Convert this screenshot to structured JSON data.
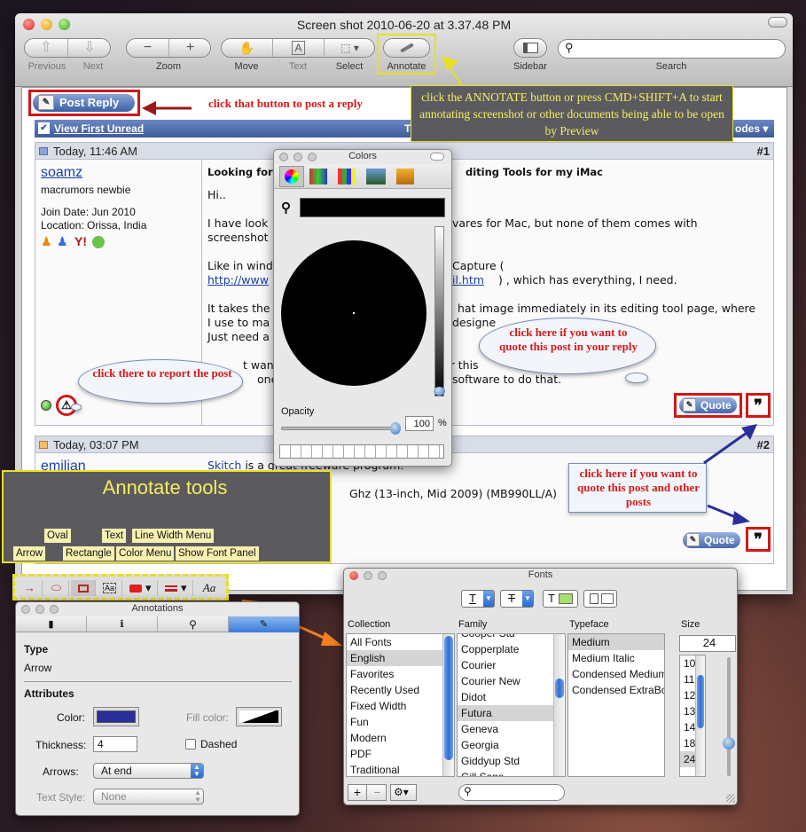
{
  "window": {
    "title": "Screen shot 2010-06-20 at 3.37.48 PM",
    "toolbar": {
      "previous": "Previous",
      "next": "Next",
      "zoom": "Zoom",
      "move": "Move",
      "text": "Text",
      "select": "Select",
      "annotate": "Annotate",
      "sidebar": "Sidebar",
      "search": "Search"
    }
  },
  "forum": {
    "post_reply_button": "Post Reply",
    "view_first_unread": "View First Unread",
    "thread_tools_partial": "Thre",
    "modes_partial": "odes",
    "posts": [
      {
        "date": "Today, 11:46 AM",
        "number": "#1",
        "user": "soamz",
        "rank": "macrumors newbie",
        "join_date": "Join Date: Jun 2010",
        "location": "Location: Orissa, India",
        "title_start": "Looking for",
        "title_end": "diting Tools for my iMac",
        "lines": [
          "Hi..",
          "I have look",
          "vares for Mac, but none of them comes with",
          "screenshot",
          "Like in wind",
          "Capture (",
          "http://www",
          "il.htm",
          ") , which has everything, I need.",
          "It takes the",
          "hat image immediately in its editing tool page, where",
          "I use to ma",
          "designe",
          "Just need a",
          "t want t",
          "or this",
          "one p",
          "software to do that."
        ],
        "quote_button": "Quote"
      },
      {
        "date": "Today, 03:07 PM",
        "number": "#2",
        "user": "emilian",
        "link_text": "Skitch",
        "line1_rest": " is a great freeware program.",
        "line2": "Ghz (13-inch, Mid 2009) (MB990LL/A)",
        "quote_button": "Quote"
      }
    ]
  },
  "callouts": {
    "post_reply": "click that button to post a reply",
    "annotate": "click the ANNOTATE button or press CMD+SHIFT+A to start annotating screenshot or other documents being able to be open by Preview",
    "quote_post": "click here if you want to quote this post in your reply",
    "report": "click there to report the post",
    "multi_quote": "click here if you want to quote this post and other posts"
  },
  "colors_panel": {
    "title": "Colors",
    "opacity_label": "Opacity",
    "opacity_value": "100",
    "percent": "%"
  },
  "annotate_tools": {
    "title": "Annotate tools",
    "labels": {
      "oval": "Oval",
      "text": "Text",
      "line_width": "Line Width Menu",
      "arrow": "Arrow",
      "rectangle": "Rectangle",
      "color_menu": "Color Menu",
      "font_panel": "Show Font Panel"
    },
    "text_glyph": "Aa"
  },
  "annotations_panel": {
    "title": "Annotations",
    "type_heading": "Type",
    "type_value": "Arrow",
    "attributes_heading": "Attributes",
    "color_label": "Color:",
    "fill_label": "Fill color:",
    "thickness_label": "Thickness:",
    "thickness_value": "4",
    "dashed_label": "Dashed",
    "arrows_label": "Arrows:",
    "arrows_value": "At end",
    "text_style_label": "Text Style:",
    "text_style_value": "None",
    "color_value": "#2a2e9a"
  },
  "fonts_panel": {
    "title": "Fonts",
    "headers": {
      "collection": "Collection",
      "family": "Family",
      "typeface": "Typeface",
      "size": "Size"
    },
    "collections": [
      "All Fonts",
      "English",
      "Favorites",
      "Recently Used",
      "Fixed Width",
      "Fun",
      "Modern",
      "PDF",
      "Traditional"
    ],
    "families": [
      "Cooper Std",
      "Copperplate",
      "Courier",
      "Courier New",
      "Didot",
      "Futura",
      "Geneva",
      "Georgia",
      "Giddyup Std",
      "Gill Sans"
    ],
    "typefaces": [
      "Medium",
      "Medium Italic",
      "Condensed Medium",
      "Condensed ExtraBo"
    ],
    "size_value": "24",
    "sizes": [
      "10",
      "11",
      "12",
      "13",
      "14",
      "18",
      "24"
    ],
    "text_glyph": "T"
  }
}
